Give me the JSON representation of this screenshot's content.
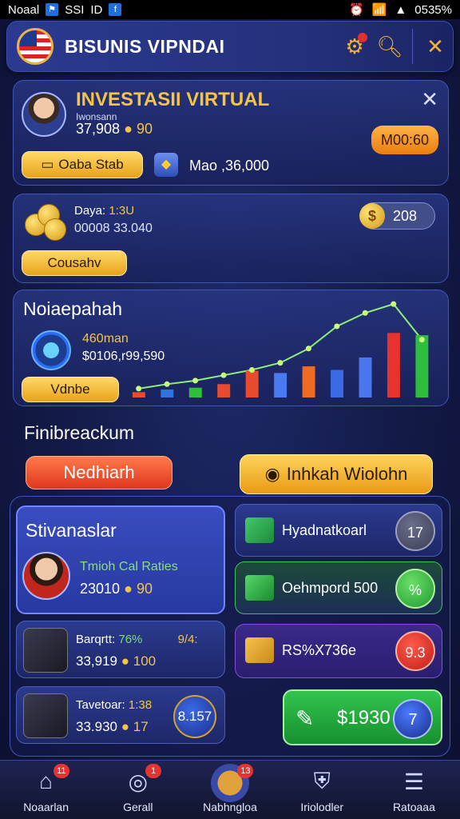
{
  "status_bar": {
    "carrier": "Noaal",
    "icons_left": [
      "SSI",
      "ID"
    ],
    "battery": "0535%"
  },
  "header": {
    "title": "BISUNIS VIPNDAI"
  },
  "profile": {
    "title": "INVESTASII VIRTUAL",
    "subtitle": "Iwonsann",
    "amount": "37,908",
    "amount_coin": "90",
    "right_button": "M00:60",
    "left_button": "Oaba Stab",
    "info": "Mao ,36,000"
  },
  "balance": {
    "label": "Daya:",
    "label_value": "1:3U",
    "line2": "00008 33.040",
    "button": "Cousahv",
    "coin_value": "208"
  },
  "chart_card": {
    "title": "Noiaepahah",
    "line1": "460man",
    "line2": "$0106,r99,590",
    "button": "Vdnbe"
  },
  "chart_data": {
    "type": "bar",
    "values": [
      12,
      18,
      22,
      30,
      60,
      55,
      70,
      62,
      90,
      145,
      140
    ],
    "line": [
      20,
      30,
      38,
      50,
      62,
      78,
      110,
      160,
      190,
      210,
      130
    ],
    "colors": [
      "#e84b2e",
      "#2f72e0",
      "#2fbd3e",
      "#e84b2e",
      "#e84b2e",
      "#4a7af0",
      "#f06a20",
      "#3a6ae6",
      "#4a78ec",
      "#e8322e",
      "#2fbd3e"
    ]
  },
  "section": {
    "title": "Finibreackum",
    "red_button": "Nedhiarh",
    "gold_tab": "Inhkah Wiolohn"
  },
  "featured": {
    "title": "Stivanaslar",
    "line1": "Tmioh Cal Raties",
    "amount": "23010",
    "coin": "90"
  },
  "mini_cards": [
    {
      "label": "Barqrtt:",
      "pct": "76%",
      "tag": "9/4:",
      "amount": "33,919",
      "coin": "100"
    },
    {
      "label": "Tavetoar:",
      "pct": "1:38",
      "amount": "33.930",
      "coin": "17",
      "circle": "8.157"
    }
  ],
  "rows": [
    {
      "text": "Hyadnatkoarl",
      "badge": "17"
    },
    {
      "text": "Oehmpord 500",
      "badge": "%"
    },
    {
      "text": "RS%X736e",
      "badge": "9.3"
    }
  ],
  "green_button": {
    "amount": "$1930",
    "circle": "7"
  },
  "nav": [
    {
      "label": "Noaarlan",
      "badge": "11"
    },
    {
      "label": "Gerall",
      "badge": "1"
    },
    {
      "label": "Nabhngloa",
      "badge": "13"
    },
    {
      "label": "Iriolodler",
      "badge": ""
    },
    {
      "label": "Ratoaaa",
      "badge": ""
    }
  ]
}
